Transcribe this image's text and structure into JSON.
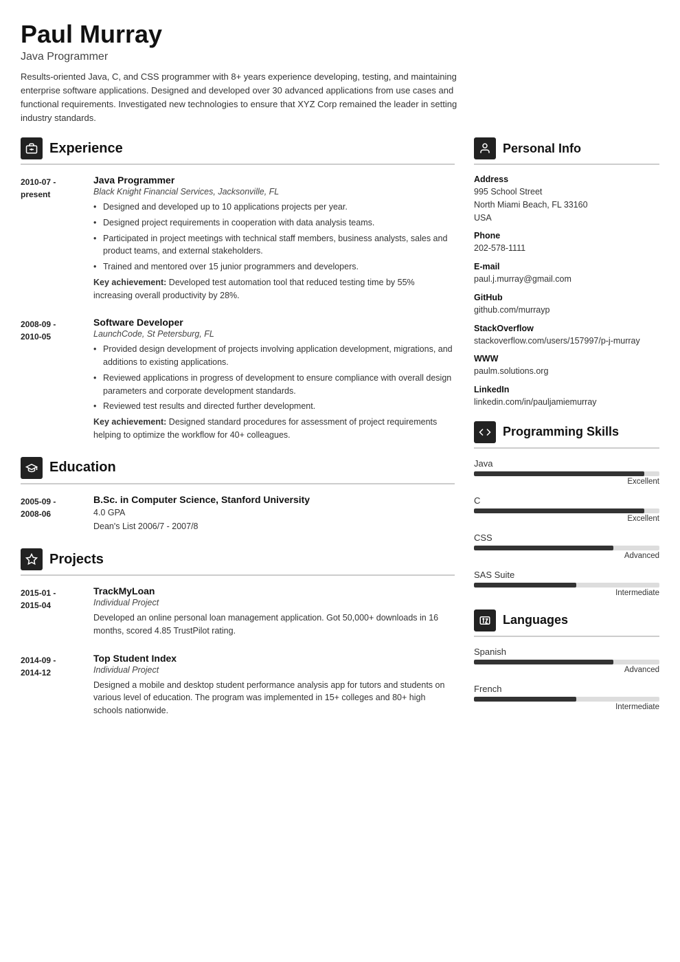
{
  "header": {
    "name": "Paul Murray",
    "title": "Java Programmer",
    "summary": "Results-oriented Java, C, and CSS programmer with 8+ years experience developing, testing, and maintaining enterprise software applications. Designed and developed over 30 advanced applications from use cases and functional requirements. Investigated new technologies to ensure that XYZ Corp remained the leader in setting industry standards."
  },
  "sections": {
    "experience_label": "Experience",
    "education_label": "Education",
    "projects_label": "Projects",
    "personal_info_label": "Personal Info",
    "programming_skills_label": "Programming Skills",
    "languages_label": "Languages"
  },
  "experience": [
    {
      "dates": "2010-07 - present",
      "role": "Java Programmer",
      "company": "Black Knight Financial Services, Jacksonville, FL",
      "bullets": [
        "Designed and developed up to 10 applications projects per year.",
        "Designed project requirements in cooperation with data analysis teams.",
        "Participated in project meetings with technical staff members, business analysts, sales and product teams, and external stakeholders.",
        "Trained and mentored over 15 junior programmers and developers."
      ],
      "key_achievement": "Developed test automation tool that reduced testing time by 55% increasing overall productivity by 28%."
    },
    {
      "dates": "2008-09 - 2010-05",
      "role": "Software Developer",
      "company": "LaunchCode, St Petersburg, FL",
      "bullets": [
        "Provided design development of projects involving application development, migrations, and additions to existing applications.",
        "Reviewed applications in progress of development to ensure compliance with overall design parameters and corporate development standards.",
        "Reviewed test results and directed further development."
      ],
      "key_achievement": "Designed standard procedures for assessment of project requirements helping to optimize the workflow for 40+ colleagues."
    }
  ],
  "education": [
    {
      "dates": "2005-09 - 2008-06",
      "degree": "B.Sc. in Computer Science, Stanford University",
      "gpa": "4.0 GPA",
      "extra": "Dean's List 2006/7 - 2007/8"
    }
  ],
  "projects": [
    {
      "dates": "2015-01 - 2015-04",
      "title": "TrackMyLoan",
      "type": "Individual Project",
      "description": "Developed an online personal loan management application. Got 50,000+ downloads in 16 months, scored 4.85 TrustPilot rating."
    },
    {
      "dates": "2014-09 - 2014-12",
      "title": "Top Student Index",
      "type": "Individual Project",
      "description": "Designed a mobile and desktop student performance analysis app for tutors and students on various level of education. The program was implemented in 15+ colleges and 80+ high schools nationwide."
    }
  ],
  "personal_info": {
    "address_label": "Address",
    "address_line1": "995 School Street",
    "address_line2": "North Miami Beach, FL 33160",
    "address_line3": "USA",
    "phone_label": "Phone",
    "phone": "202-578-1111",
    "email_label": "E-mail",
    "email": "paul.j.murray@gmail.com",
    "github_label": "GitHub",
    "github": "github.com/murrayp",
    "stackoverflow_label": "StackOverflow",
    "stackoverflow": "stackoverflow.com/users/157997/p-j-murray",
    "www_label": "WWW",
    "www": "paulm.solutions.org",
    "linkedin_label": "LinkedIn",
    "linkedin": "linkedin.com/in/pauljamiemurray"
  },
  "programming_skills": [
    {
      "name": "Java",
      "level": "Excellent",
      "pct": 92
    },
    {
      "name": "C",
      "level": "Excellent",
      "pct": 92
    },
    {
      "name": "CSS",
      "level": "Advanced",
      "pct": 75
    },
    {
      "name": "SAS Suite",
      "level": "Intermediate",
      "pct": 55
    }
  ],
  "languages": [
    {
      "name": "Spanish",
      "level": "Advanced",
      "pct": 75
    },
    {
      "name": "French",
      "level": "Intermediate",
      "pct": 55
    }
  ],
  "icons": {
    "experience": "💼",
    "education": "🎓",
    "projects": "⭐",
    "personal_info": "👤",
    "programming_skills": "⚙️",
    "languages": "🌐"
  }
}
